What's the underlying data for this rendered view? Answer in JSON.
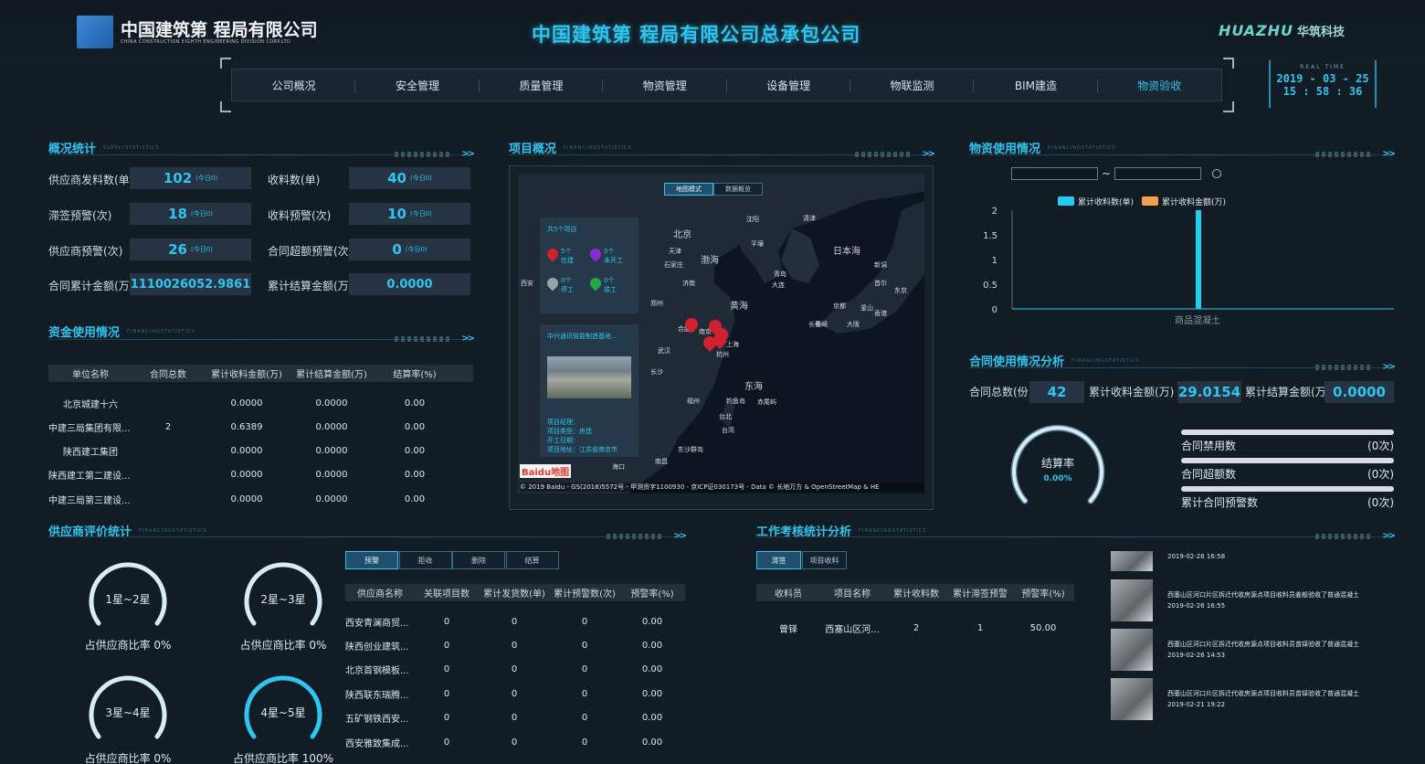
{
  "header": {
    "logo_cn": "中国建筑第 程局有限公司",
    "logo_en": "CHINA CONSTRUCTION EIGHTH ENGINEERING DIVISION CORP.LTD",
    "title": "中国建筑第 程局有限公司总承包公司",
    "brand_en": "HUAZHU",
    "brand_cn": "华筑科技",
    "realtime_label": "REAL TIME",
    "date": "2019 - 03 - 25",
    "time": "15 : 58 : 36"
  },
  "nav": {
    "items": [
      "公司概况",
      "安全管理",
      "质量管理",
      "物资管理",
      "设备管理",
      "物联监测",
      "BIM建造",
      "物资验收"
    ],
    "active_index": 7
  },
  "overview": {
    "title": "概况统计",
    "subtitle": "SUPPLYSTATISTICS",
    "stats": [
      {
        "label": "供应商发料数(单)",
        "value": "102",
        "unit": "(今日0)"
      },
      {
        "label": "收料数(单)",
        "value": "40",
        "unit": "(今日0)"
      },
      {
        "label": "滞签预警(次)",
        "value": "18",
        "unit": "(今日0)"
      },
      {
        "label": "收料预警(次)",
        "value": "10",
        "unit": "(今日0)"
      },
      {
        "label": "供应商预警(次)",
        "value": "26",
        "unit": "(今日0)"
      },
      {
        "label": "合同超额预警(次)",
        "value": "0",
        "unit": "(今日0)"
      },
      {
        "label": "合同累计金额(万)",
        "value": "1110026052.9861",
        "unit": ""
      },
      {
        "label": "累计结算金额(万)",
        "value": "0.0000",
        "unit": ""
      }
    ]
  },
  "funds": {
    "title": "资金使用情况",
    "subtitle": "FINANCINGSTATISTICS",
    "headers": [
      "单位名称",
      "合同总数",
      "累计收料金额(万)",
      "累计结算金额(万)",
      "结算率(%)"
    ],
    "rows": [
      [
        "北京城建十六",
        "",
        "0.0000",
        "0.0000",
        "0.00"
      ],
      [
        "中建三局集团有限...",
        "2",
        "0.6389",
        "0.0000",
        "0.00"
      ],
      [
        "陕西建工集团",
        "",
        "0.0000",
        "0.0000",
        "0.00"
      ],
      [
        "陕西建工第二建设...",
        "",
        "0.0000",
        "0.0000",
        "0.00"
      ],
      [
        "中建三局第三建设...",
        "",
        "0.0000",
        "0.0000",
        "0.00"
      ]
    ]
  },
  "project": {
    "title": "项目概况",
    "subtitle": "FINANCINGSTATISTICS",
    "map_btn_1": "地图模式",
    "map_btn_2": "数据概览",
    "count_title": "共5个项目",
    "status": [
      {
        "count": "5个",
        "label": "在建",
        "color": "#d2202e"
      },
      {
        "count": "0个",
        "label": "未开工",
        "color": "#8a2bd6"
      },
      {
        "count": "0个",
        "label": "停工",
        "color": "#9aa3ab"
      },
      {
        "count": "0个",
        "label": "竣工",
        "color": "#28a745"
      }
    ],
    "card_title": "中兴通讯智能制造基地...",
    "card_info": [
      "项目经理：",
      "项目类型：房建",
      "开工日期：",
      "项目地址：江苏省南京市"
    ],
    "map_labels": [
      "北京",
      "天津",
      "渤海",
      "日本海",
      "黄海",
      "东海",
      "上海",
      "杭州",
      "南京",
      "合肥",
      "武汉",
      "长沙",
      "福州",
      "台北",
      "台湾",
      "济南",
      "郑州",
      "西安",
      "石家庄",
      "沈阳",
      "大连",
      "青岛",
      "首尔",
      "釜山",
      "东京",
      "大阪",
      "长崎",
      "南昌",
      "香港",
      "海口",
      "东沙群岛",
      "钓鱼岛",
      "赤尾屿",
      "平壤",
      "清津",
      "长春",
      "京都",
      "新潟"
    ],
    "copyright": "© 2019 Baidu - GS(2018)5572号 - 甲测资字1100930 - 京ICP证030173号 - Data © 长地万方 & OpenStreetMap & HE",
    "baidu": "Baidu地图"
  },
  "materials": {
    "title": "物资使用情况",
    "subtitle": "FINANCINGSTATISTICS",
    "date_sep": "~"
  },
  "chart_data": {
    "type": "bar",
    "categories": [
      "商品混凝土"
    ],
    "series": [
      {
        "name": "累计收料数(单)",
        "values": [
          2
        ],
        "color": "#22cdf3"
      },
      {
        "name": "累计收料金额(万)",
        "values": [
          0
        ],
        "color": "#f5a049"
      }
    ],
    "ylim": [
      0,
      2
    ],
    "yticks": [
      "0",
      "0.5",
      "1",
      "1.5",
      "2"
    ],
    "legend": "top"
  },
  "contract": {
    "title": "合同使用情况分析",
    "subtitle": "FINANCINGSTATISTICS",
    "total_label": "合同总数(份)",
    "total_value": "42",
    "recv_label": "累计收料金额(万)",
    "recv_value": "29.0154",
    "settle_label": "累计结算金额(万)",
    "settle_value": "0.0000",
    "gauge_label": "结算率",
    "gauge_value": "0.00%",
    "bars": [
      {
        "label": "合同禁用数",
        "value": "(0次)",
        "fraction": 0
      },
      {
        "label": "合同超额数",
        "value": "(0次)",
        "fraction": 0
      },
      {
        "label": "累计合同预警数",
        "value": "(0次)",
        "fraction": 0
      }
    ]
  },
  "supplier": {
    "title": "供应商评价统计",
    "subtitle": "FINANCINGSTATISTICS",
    "gauges": [
      {
        "label": "1星~2星",
        "ratio": "占供应商比率 0%",
        "fraction": 0
      },
      {
        "label": "2星~3星",
        "ratio": "占供应商比率 0%",
        "fraction": 0
      },
      {
        "label": "3星~4星",
        "ratio": "占供应商比率 0%",
        "fraction": 0
      },
      {
        "label": "4星~5星",
        "ratio": "占供应商比率 100%",
        "fraction": 1
      }
    ],
    "buttons": [
      "预警",
      "拒收",
      "删除",
      "结算"
    ],
    "headers": [
      "供应商名称",
      "关联项目数",
      "累计发货数(单)",
      "累计预警数(次)",
      "预警率(%)"
    ],
    "rows": [
      [
        "西安青澜商贸...",
        "0",
        "0",
        "0",
        "0.00"
      ],
      [
        "陕西创业建筑...",
        "0",
        "0",
        "0",
        "0.00"
      ],
      [
        "北京首钢模板...",
        "0",
        "0",
        "0",
        "0.00"
      ],
      [
        "陕西联东瑞腾...",
        "0",
        "0",
        "0",
        "0.00"
      ],
      [
        "五矿钢铁西安...",
        "0",
        "0",
        "0",
        "0.00"
      ],
      [
        "西安雅致集成...",
        "0",
        "0",
        "0",
        "0.00"
      ]
    ]
  },
  "work": {
    "title": "工作考核统计分析",
    "subtitle": "FINANCINGSTATISTICS",
    "buttons": [
      "滞签",
      "项目收料"
    ],
    "headers": [
      "收料员",
      "项目名称",
      "累计收料数",
      "累计滞签预警",
      "预警率(%)"
    ],
    "rows": [
      [
        "曾铎",
        "西塞山区河...",
        "2",
        "1",
        "50.00"
      ]
    ],
    "feed": [
      {
        "text": "",
        "time": "2019-02-26 16:58"
      },
      {
        "text": "西塞山区河口片区拆迁代收房源点项目收料员姜般验收了普通混凝土",
        "time": "2019-02-26 16:55"
      },
      {
        "text": "西塞山区河口片区拆迁代收房源点项目收料员曾铎验收了普通混凝土",
        "time": "2019-02-26 14:53"
      },
      {
        "text": "西塞山区河口片区拆迁代收房源点项目收料员曾铎验收了普通混凝土",
        "time": "2019-02-21 19:22"
      }
    ]
  },
  "colors": {
    "accent": "#22cdf3",
    "bg": "#121c25",
    "panel": "#253343"
  }
}
